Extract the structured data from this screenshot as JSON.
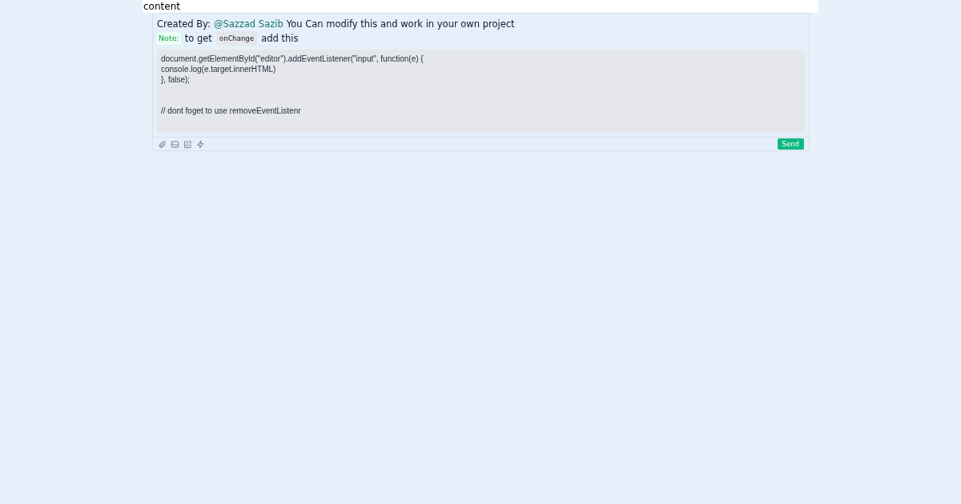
{
  "header": {
    "title": "content"
  },
  "credit": {
    "prefix": "Created By:",
    "author": "@Sazzad Sazib",
    "suffix": "You Can modify this and work in your own project"
  },
  "note": {
    "badge": "Note:",
    "before": "to get",
    "code": "onChange",
    "after": "add this"
  },
  "editor": {
    "value": "document.getElementById(\"editor\").addEventListener(\"input\", function(e) {\nconsole.log(e.target.innerHTML)\n}, false);\n\n\n// dont foget to use removeEventListenr"
  },
  "toolbar": {
    "send_button": "Send"
  }
}
